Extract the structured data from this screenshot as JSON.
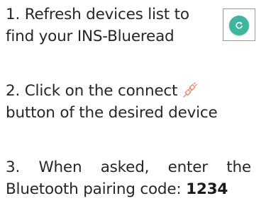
{
  "step1": {
    "line1": "1. Refresh devices list to",
    "line2": "find your INS-Blueread"
  },
  "refresh_button": {
    "icon": "refresh-icon",
    "color": "#3eb69d"
  },
  "step2": {
    "line1": "2. Click on the connect",
    "line2": "button of the desired device",
    "icon": "connect-plug-icon",
    "icon_color": "#e8836b"
  },
  "step3": {
    "line1_words": [
      "3.",
      "When",
      "asked,",
      "enter",
      "the"
    ],
    "line2_prefix": "Bluetooth pairing code:",
    "code": "1234"
  }
}
